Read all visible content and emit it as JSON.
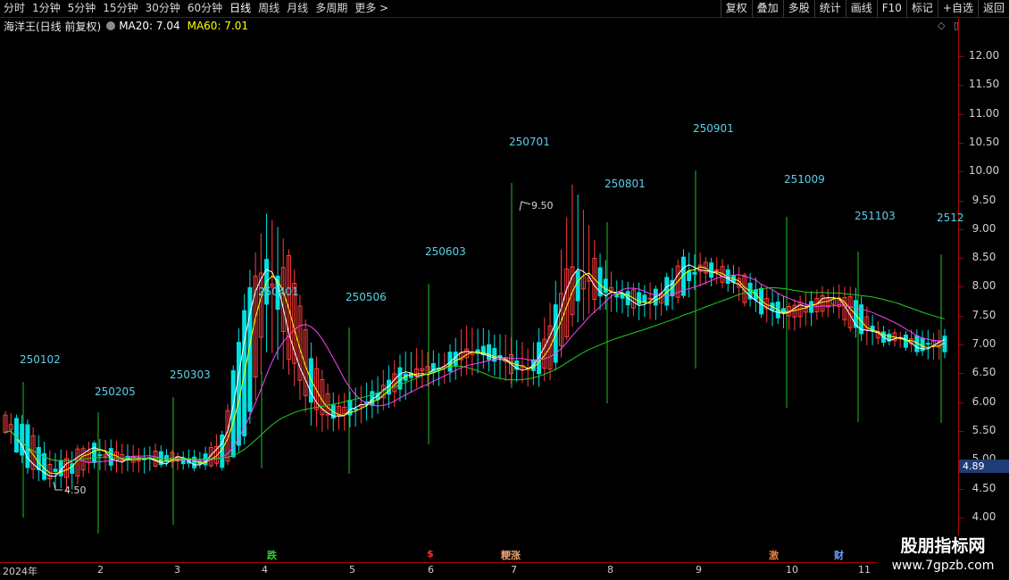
{
  "toolbar": {
    "periods": [
      "分时",
      "1分钟",
      "5分钟",
      "15分钟",
      "30分钟",
      "60分钟",
      "日线",
      "周线",
      "月线",
      "多周期",
      "更多 >"
    ],
    "active_period": "日线",
    "actions": [
      "复权",
      "叠加",
      "多股",
      "统计",
      "画线",
      "F10",
      "标记",
      "+自选",
      "返回"
    ]
  },
  "info": {
    "title": "海洋王(日线 前复权)",
    "ma20_label": "MA20: 7.04",
    "ma60_label": "MA60: 7.01"
  },
  "icons": [
    "diamond-icon",
    "expand-icon"
  ],
  "price_axis": [
    "12.00",
    "11.50",
    "11.00",
    "10.50",
    "10.00",
    "9.50",
    "9.00",
    "8.50",
    "8.00",
    "7.50",
    "7.00",
    "6.50",
    "6.00",
    "5.50",
    "5.00",
    "4.50",
    "4.00"
  ],
  "current_price": "4.89",
  "annotations": {
    "high": "9.50",
    "low": "4.50"
  },
  "date_labels": [
    "250102",
    "250205",
    "250303",
    "250401",
    "250506",
    "250603",
    "250701",
    "250801",
    "250901",
    "251009",
    "251103",
    "2512"
  ],
  "months": [
    "2024年",
    "2",
    "3",
    "4",
    "5",
    "6",
    "7",
    "8",
    "9",
    "10",
    "11"
  ],
  "markers": [
    {
      "text": "跌",
      "color": "#30d030"
    },
    {
      "text": "$",
      "color": "#ff3030"
    },
    {
      "text": "粳涨",
      "color": "#e8a070"
    },
    {
      "text": "激",
      "color": "#e08040"
    },
    {
      "text": "财",
      "color": "#6aa0ff"
    }
  ],
  "watermark": {
    "name": "股朋指标网",
    "url": "www.7gpzb.com"
  },
  "colors": {
    "up": "#ff3c3c",
    "down": "#00e0e0",
    "ma_white": "#ffffff",
    "ma_yellow": "#ffff00",
    "ma_magenta": "#ff40ff",
    "ma_green": "#20d020",
    "vline": "#20c020"
  },
  "chart_data": {
    "type": "candlestick",
    "ylim": [
      4.0,
      12.0
    ],
    "ohlc_sampled": [
      [
        5.7,
        5.8,
        5.5,
        5.6
      ],
      [
        5.6,
        5.7,
        4.8,
        4.9
      ],
      [
        4.9,
        5.1,
        4.6,
        4.7
      ],
      [
        4.7,
        5.1,
        4.5,
        5.0
      ],
      [
        5.0,
        5.3,
        4.9,
        5.2
      ],
      [
        5.2,
        5.3,
        4.8,
        4.9
      ],
      [
        4.9,
        5.2,
        4.8,
        5.1
      ],
      [
        5.1,
        5.2,
        4.9,
        5.0
      ],
      [
        5.0,
        5.1,
        4.9,
        5.0
      ],
      [
        5.0,
        5.1,
        4.9,
        4.9
      ],
      [
        4.9,
        5.5,
        4.9,
        5.4
      ],
      [
        5.4,
        8.0,
        5.3,
        7.8
      ],
      [
        7.8,
        9.3,
        7.0,
        8.5
      ],
      [
        8.5,
        8.6,
        6.5,
        6.8
      ],
      [
        6.8,
        7.0,
        5.6,
        5.9
      ],
      [
        5.9,
        6.1,
        5.5,
        5.8
      ],
      [
        5.8,
        6.2,
        5.6,
        6.0
      ],
      [
        6.0,
        6.4,
        5.8,
        6.2
      ],
      [
        6.2,
        6.8,
        6.0,
        6.6
      ],
      [
        6.6,
        6.9,
        6.3,
        6.5
      ],
      [
        6.5,
        6.8,
        6.3,
        6.7
      ],
      [
        6.7,
        7.3,
        6.5,
        7.0
      ],
      [
        7.0,
        7.2,
        6.6,
        6.8
      ],
      [
        6.8,
        7.1,
        6.4,
        6.6
      ],
      [
        6.6,
        6.9,
        6.3,
        6.5
      ],
      [
        6.5,
        7.7,
        6.4,
        7.5
      ],
      [
        7.5,
        9.8,
        7.4,
        8.5
      ],
      [
        8.5,
        8.7,
        7.6,
        7.8
      ],
      [
        7.8,
        8.1,
        7.6,
        7.9
      ],
      [
        7.9,
        8.0,
        7.5,
        7.7
      ],
      [
        7.7,
        8.0,
        7.5,
        7.9
      ],
      [
        7.9,
        8.6,
        7.8,
        8.4
      ],
      [
        8.4,
        8.5,
        8.1,
        8.3
      ],
      [
        8.3,
        8.4,
        8.0,
        8.1
      ],
      [
        8.1,
        8.2,
        7.7,
        7.8
      ],
      [
        7.8,
        7.9,
        7.4,
        7.5
      ],
      [
        7.5,
        7.7,
        7.3,
        7.6
      ],
      [
        7.6,
        7.9,
        7.4,
        7.7
      ],
      [
        7.7,
        8.0,
        7.6,
        7.8
      ],
      [
        7.8,
        7.9,
        7.1,
        7.2
      ],
      [
        7.2,
        7.3,
        7.0,
        7.1
      ],
      [
        7.1,
        7.2,
        7.0,
        7.1
      ],
      [
        7.1,
        7.2,
        6.8,
        6.9
      ],
      [
        6.9,
        7.2,
        6.8,
        7.1
      ]
    ],
    "ma_series": [
      "MA20",
      "MA60"
    ]
  }
}
